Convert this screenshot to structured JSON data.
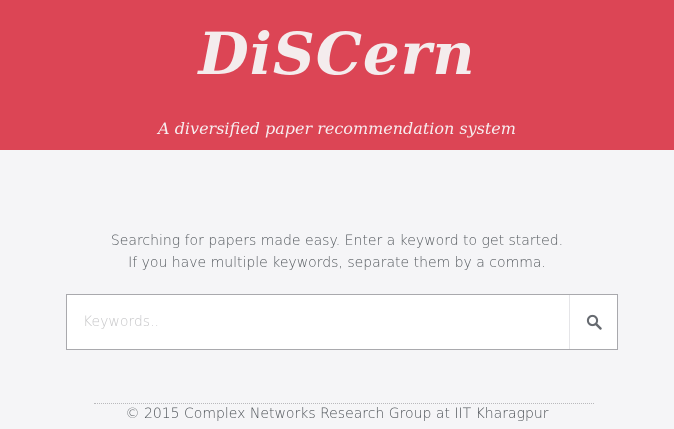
{
  "header": {
    "brand": "DiSCern",
    "tagline": "A diversified paper recommendation system"
  },
  "intro": {
    "line1": "Searching for papers made easy. Enter a keyword to get started.",
    "line2": "If you have multiple keywords, separate them by a comma."
  },
  "search": {
    "placeholder": "Keywords..",
    "value": "",
    "button_icon": "search-icon"
  },
  "footer": {
    "text": "© 2015 Complex Networks Research Group at IIT Kharagpur"
  },
  "colors": {
    "header_bg": "#dc4555",
    "page_bg": "#f5f5f7"
  }
}
